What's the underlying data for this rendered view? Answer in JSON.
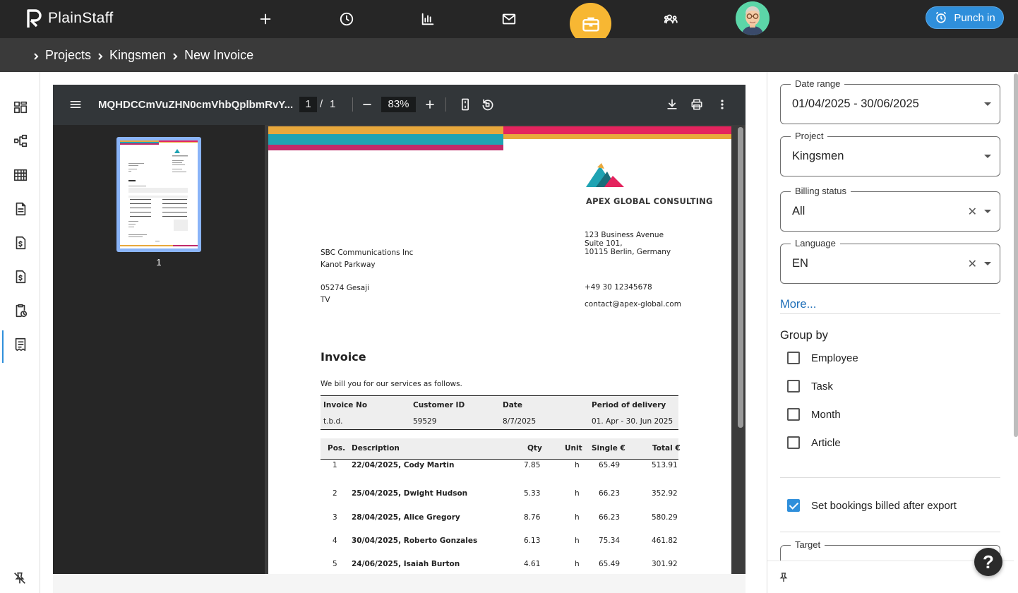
{
  "app": {
    "name": "PlainStaff"
  },
  "topnav": {
    "icons": [
      "plus-icon",
      "clock-icon",
      "bar-chart-icon",
      "mail-icon",
      "briefcase-icon",
      "team-icon"
    ],
    "punch_label": "Punch in",
    "accent": "#f7b733",
    "punch_color": "#2f8fdb"
  },
  "breadcrumb": [
    "Projects",
    "Kingsmen",
    "New Invoice"
  ],
  "sidebar": {
    "icons": [
      "dashboard-icon",
      "hierarchy-icon",
      "table-icon",
      "document-icon",
      "invoice-dollar-icon",
      "receipt-dollar-icon",
      "clipboard-clock-icon",
      "invoice-list-icon"
    ],
    "active": "invoice-list-icon"
  },
  "pdf_viewer": {
    "title": "MQHDCCmVuZHN0cmVhbQplbmRvY...",
    "page_current": "1",
    "page_sep": "/",
    "page_total": "1",
    "zoom": "83%",
    "thumbnail_label": "1"
  },
  "invoice": {
    "company_name": "APEX GLOBAL CONSULTING",
    "company_address": [
      "123 Business Avenue",
      "Suite 101,",
      "10115 Berlin, Germany"
    ],
    "company_phone": "+49 30 12345678",
    "company_email": "contact@apex-global.com",
    "recipient": [
      "SBC Communications Inc",
      "Kanot Parkway",
      "",
      "05274 Gesaji",
      "TV"
    ],
    "title": "Invoice",
    "intro": "We bill you for our services as follows.",
    "meta_headers": [
      "Invoice No",
      "Customer ID",
      "Date",
      "Period of delivery"
    ],
    "meta_values": [
      "t.b.d.",
      "59529",
      "8/7/2025",
      "01. Apr  - 30. Jun 2025"
    ],
    "item_headers": [
      "Pos.",
      "Description",
      "Qty",
      "Unit",
      "Single €",
      "Total €"
    ],
    "items": [
      [
        "1",
        "22/04/2025, Cody Martin",
        "7.85",
        "h",
        "65.49",
        "513.91"
      ],
      [
        "2",
        "25/04/2025, Dwight Hudson",
        "5.33",
        "h",
        "66.23",
        "352.92"
      ],
      [
        "3",
        "28/04/2025, Alice Gregory",
        "8.76",
        "h",
        "66.23",
        "580.29"
      ],
      [
        "4",
        "30/04/2025, Roberto Gonzales",
        "6.13",
        "h",
        "75.34",
        "461.82"
      ],
      [
        "5",
        "24/06/2025, Isaiah Burton",
        "4.61",
        "h",
        "65.49",
        "301.92"
      ]
    ]
  },
  "filters": {
    "date_range": {
      "label": "Date range",
      "value": "01/04/2025 - 30/06/2025"
    },
    "project": {
      "label": "Project",
      "value": "Kingsmen"
    },
    "billing_status": {
      "label": "Billing status",
      "value": "All"
    },
    "language": {
      "label": "Language",
      "value": "EN"
    },
    "clear_symbol": "✕",
    "more_label": "More...",
    "group_by_label": "Group by",
    "group_by_options": [
      {
        "label": "Employee",
        "checked": false
      },
      {
        "label": "Task",
        "checked": false
      },
      {
        "label": "Month",
        "checked": false
      },
      {
        "label": "Article",
        "checked": false
      }
    ],
    "set_billed_label": "Set bookings billed after export",
    "set_billed_checked": true,
    "target_label": "Target"
  },
  "help_label": "?"
}
